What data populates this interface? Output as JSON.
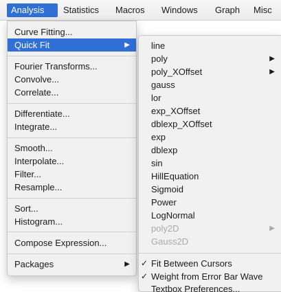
{
  "menubar": {
    "items": [
      "Analysis",
      "Statistics",
      "Macros",
      "Windows",
      "Graph",
      "Misc"
    ],
    "active_index": 0
  },
  "analysis_menu": {
    "items": [
      {
        "label": "Curve Fitting..."
      },
      {
        "label": "Quick Fit",
        "submenu_arrow": "▶",
        "highlighted": true
      },
      {
        "label": "Fourier Transforms..."
      },
      {
        "label": "Convolve..."
      },
      {
        "label": "Correlate..."
      },
      {
        "label": "Differentiate..."
      },
      {
        "label": "Integrate..."
      },
      {
        "label": "Smooth..."
      },
      {
        "label": "Interpolate..."
      },
      {
        "label": "Filter..."
      },
      {
        "label": "Resample..."
      },
      {
        "label": "Sort..."
      },
      {
        "label": "Histogram..."
      },
      {
        "label": "Compose Expression..."
      },
      {
        "label": "Packages",
        "submenu_arrow": "▶"
      }
    ]
  },
  "quick_fit_menu": {
    "items": [
      {
        "label": "line"
      },
      {
        "label": "poly",
        "submenu_arrow": "▶"
      },
      {
        "label": "poly_XOffset",
        "submenu_arrow": "▶"
      },
      {
        "label": "gauss"
      },
      {
        "label": "lor"
      },
      {
        "label": "exp_XOffset"
      },
      {
        "label": "dblexp_XOffset"
      },
      {
        "label": "exp"
      },
      {
        "label": "dblexp"
      },
      {
        "label": "sin"
      },
      {
        "label": "HillEquation"
      },
      {
        "label": "Sigmoid"
      },
      {
        "label": "Power"
      },
      {
        "label": "LogNormal"
      },
      {
        "label": "poly2D",
        "submenu_arrow": "▶",
        "disabled": true
      },
      {
        "label": "Gauss2D",
        "disabled": true
      }
    ],
    "options": [
      {
        "label": "Fit Between Cursors",
        "checkmark": "✓"
      },
      {
        "label": "Weight from Error Bar Wave",
        "checkmark": "✓"
      },
      {
        "label": "Textbox Preferences..."
      }
    ]
  },
  "colors": {
    "highlight": "#2f6fd6",
    "menu_bg": "#f1f1f1",
    "disabled_text": "#aaaaaa"
  }
}
